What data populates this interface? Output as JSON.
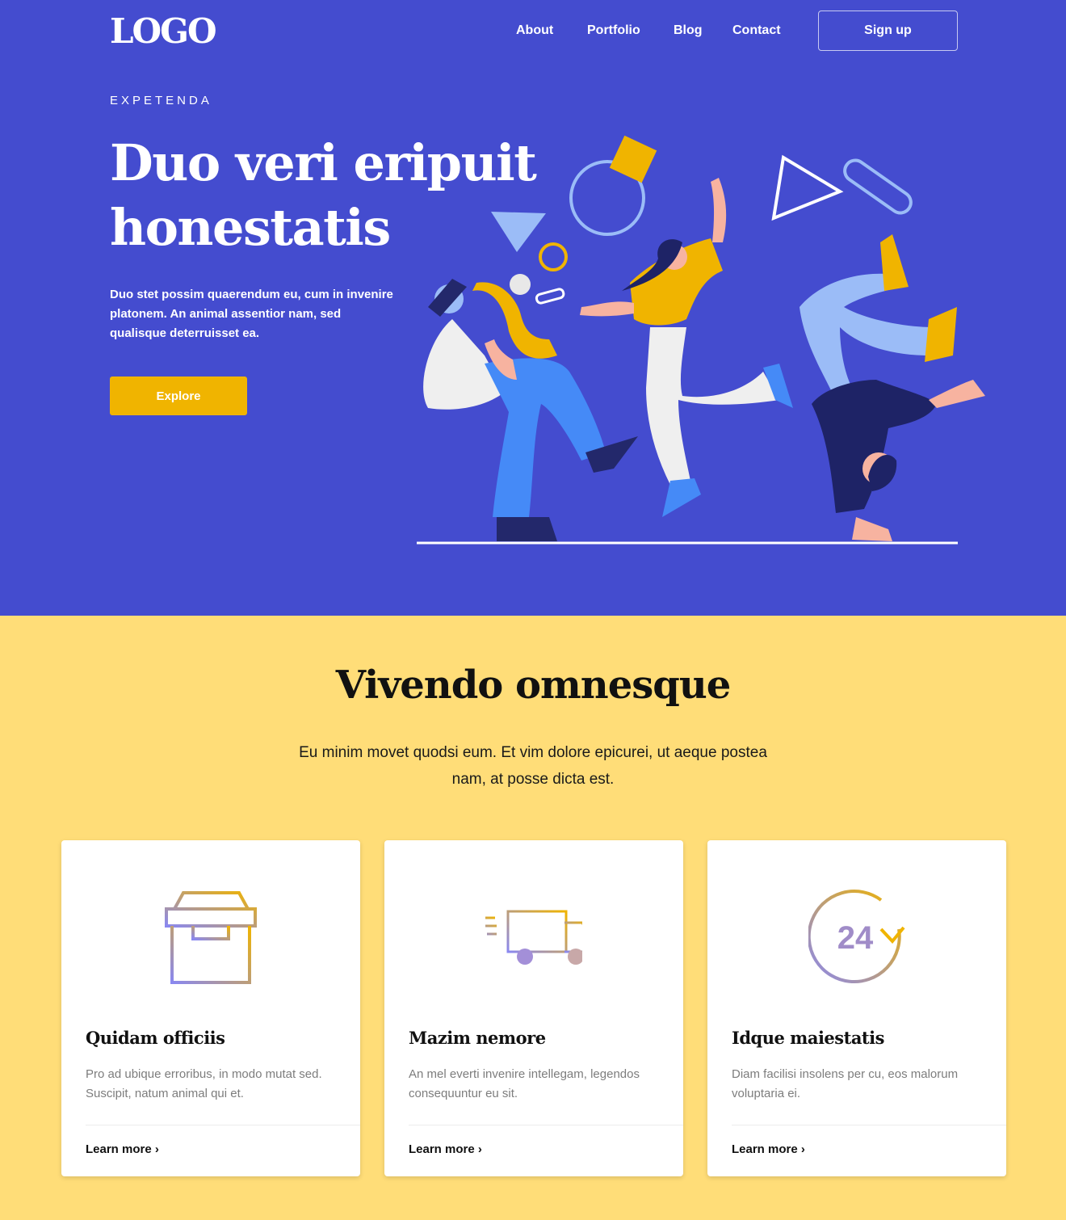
{
  "header": {
    "logo": "LOGO",
    "nav": [
      "About",
      "Portfolio",
      "Blog",
      "Contact"
    ],
    "signup_label": "Sign up"
  },
  "hero": {
    "eyebrow": "EXPETENDA",
    "title_line1": "Duo veri eripuit",
    "title_line2": "honestatis",
    "description": "Duo stet possim quaerendum eu, cum in invenire platonem. An animal assentior nam, sed qualisque deterruisset ea.",
    "cta_label": "Explore",
    "colors": {
      "background": "#444ccf",
      "accent": "#f0b400"
    }
  },
  "features": {
    "title": "Vivendo omnesque",
    "description": "Eu minim movet quodsi eum. Et vim dolore epicurei, ut aeque postea nam, at posse dicta est.",
    "background": "#ffdd78",
    "cards": [
      {
        "icon": "box-icon",
        "title": "Quidam officiis",
        "text": "Pro ad ubique erroribus, in modo mutat sed. Suscipit, natum animal qui et.",
        "link": "Learn more ›"
      },
      {
        "icon": "truck-icon",
        "title": "Mazim nemore",
        "text": "An mel everti invenire intellegam, legendos consequuntur eu sit.",
        "link": "Learn more ›"
      },
      {
        "icon": "24-hours-icon",
        "icon_text": "24",
        "title": "Idque maiestatis",
        "text": "Diam facilisi insolens per cu, eos malorum voluptaria ei.",
        "link": "Learn more ›"
      }
    ]
  }
}
